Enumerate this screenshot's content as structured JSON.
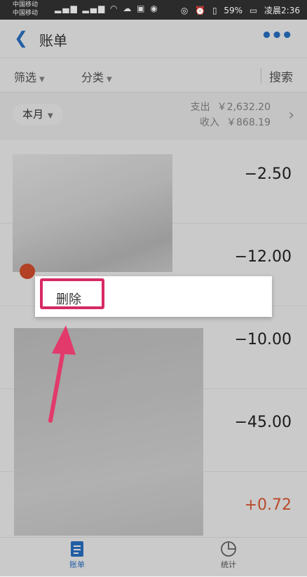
{
  "status_bar": {
    "carrier_1": "中国移动",
    "carrier_2": "中国移动",
    "battery": "59%",
    "time": "凌晨2:36"
  },
  "header": {
    "title": "账单"
  },
  "filters": {
    "filter_label": "筛选",
    "category_label": "分类",
    "search_label": "搜索"
  },
  "summary": {
    "period": "本月",
    "expense_label": "支出",
    "expense_value": "￥2,632.20",
    "income_label": "收入",
    "income_value": "￥868.19"
  },
  "transactions": [
    {
      "amount": "−2.50",
      "type": "expense"
    },
    {
      "amount": "−12.00",
      "type": "expense"
    },
    {
      "amount": "−10.00",
      "type": "expense"
    },
    {
      "amount": "−45.00",
      "type": "expense"
    },
    {
      "amount": "+0.72",
      "type": "income"
    }
  ],
  "context_menu": {
    "delete_label": "删除"
  },
  "tabbar": {
    "bill_label": "账单",
    "stats_label": "统计"
  },
  "colors": {
    "accent": "#2a73c8",
    "income": "#e35b35",
    "highlight": "#d62b63"
  }
}
